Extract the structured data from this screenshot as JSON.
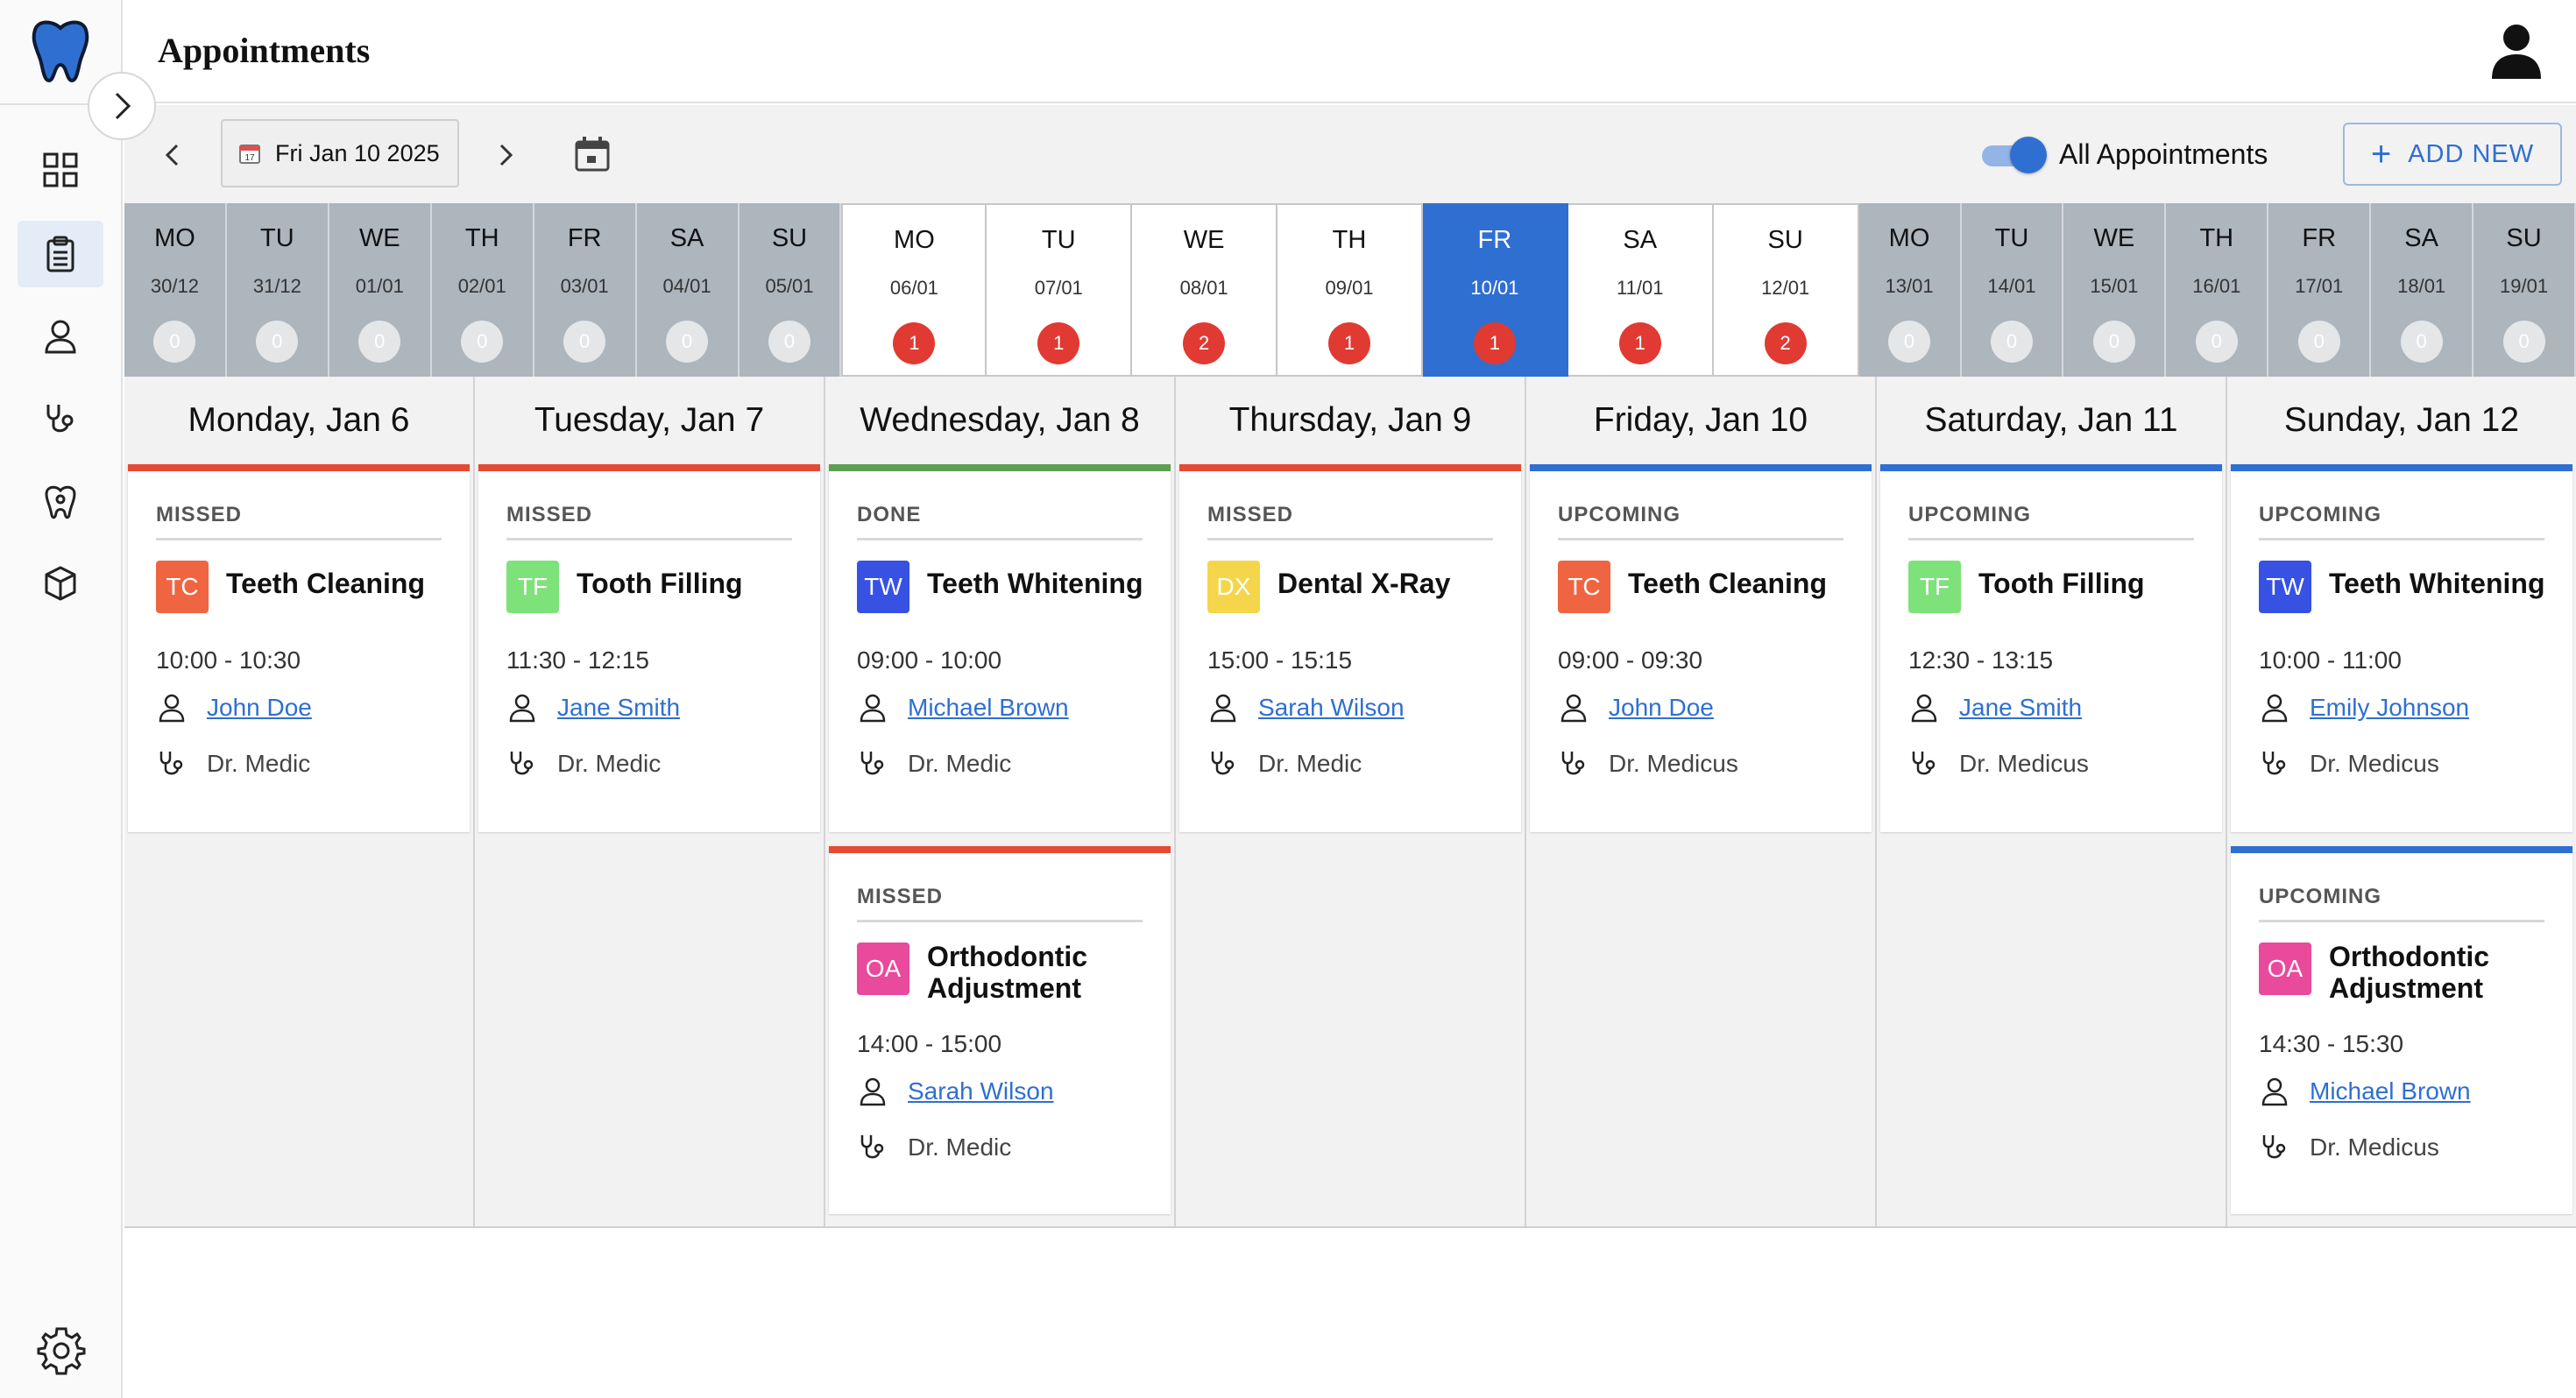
{
  "header": {
    "title": "Appointments"
  },
  "toolbar": {
    "date_label": "Fri Jan 10 2025",
    "toggle_label": "All Appointments",
    "add_new_label": "ADD NEW"
  },
  "colors": {
    "accent": "#2f6fd1",
    "missed": "#e34b34",
    "done": "#5c9f51",
    "upcoming": "#2f6fd1",
    "badge_tc": "#f06541",
    "badge_tf": "#7ee27a",
    "badge_tw": "#3751e3",
    "badge_dx": "#f5d64a",
    "badge_oa": "#e94a9b"
  },
  "days_strip": [
    {
      "dow": "MO",
      "dm": "30/12",
      "count": "0"
    },
    {
      "dow": "TU",
      "dm": "31/12",
      "count": "0"
    },
    {
      "dow": "WE",
      "dm": "01/01",
      "count": "0"
    },
    {
      "dow": "TH",
      "dm": "02/01",
      "count": "0"
    },
    {
      "dow": "FR",
      "dm": "03/01",
      "count": "0"
    },
    {
      "dow": "SA",
      "dm": "04/01",
      "count": "0"
    },
    {
      "dow": "SU",
      "dm": "05/01",
      "count": "0"
    },
    {
      "dow": "MO",
      "dm": "06/01",
      "count": "1"
    },
    {
      "dow": "TU",
      "dm": "07/01",
      "count": "1"
    },
    {
      "dow": "WE",
      "dm": "08/01",
      "count": "2"
    },
    {
      "dow": "TH",
      "dm": "09/01",
      "count": "1"
    },
    {
      "dow": "FR",
      "dm": "10/01",
      "count": "1"
    },
    {
      "dow": "SA",
      "dm": "11/01",
      "count": "1"
    },
    {
      "dow": "SU",
      "dm": "12/01",
      "count": "2"
    },
    {
      "dow": "MO",
      "dm": "13/01",
      "count": "0"
    },
    {
      "dow": "TU",
      "dm": "14/01",
      "count": "0"
    },
    {
      "dow": "WE",
      "dm": "15/01",
      "count": "0"
    },
    {
      "dow": "TH",
      "dm": "16/01",
      "count": "0"
    },
    {
      "dow": "FR",
      "dm": "17/01",
      "count": "0"
    },
    {
      "dow": "SA",
      "dm": "18/01",
      "count": "0"
    },
    {
      "dow": "SU",
      "dm": "19/01",
      "count": "0"
    }
  ],
  "week": [
    {
      "title": "Monday, Jan 6",
      "appointments": [
        {
          "status": "MISSED",
          "badge": "TC",
          "service": "Teeth Cleaning",
          "time": "10:00 - 10:30",
          "patient": "John Doe",
          "doctor": "Dr. Medic"
        }
      ]
    },
    {
      "title": "Tuesday, Jan 7",
      "appointments": [
        {
          "status": "MISSED",
          "badge": "TF",
          "service": "Tooth Filling",
          "time": "11:30 - 12:15",
          "patient": "Jane Smith",
          "doctor": "Dr. Medic"
        }
      ]
    },
    {
      "title": "Wednesday, Jan 8",
      "appointments": [
        {
          "status": "DONE",
          "badge": "TW",
          "service": "Teeth Whitening",
          "time": "09:00 - 10:00",
          "patient": "Michael Brown",
          "doctor": "Dr. Medic"
        },
        {
          "status": "MISSED",
          "badge": "OA",
          "service_line1": "Orthodontic",
          "service_line2": "Adjustment",
          "time": "14:00 - 15:00",
          "patient": "Sarah Wilson",
          "doctor": "Dr. Medic"
        }
      ]
    },
    {
      "title": "Thursday, Jan 9",
      "appointments": [
        {
          "status": "MISSED",
          "badge": "DX",
          "service": "Dental X-Ray",
          "time": "15:00 - 15:15",
          "patient": "Sarah Wilson",
          "doctor": "Dr. Medic"
        }
      ]
    },
    {
      "title": "Friday, Jan 10",
      "appointments": [
        {
          "status": "UPCOMING",
          "badge": "TC",
          "service": "Teeth Cleaning",
          "time": "09:00 - 09:30",
          "patient": "John Doe",
          "doctor": "Dr. Medicus"
        }
      ]
    },
    {
      "title": "Saturday, Jan 11",
      "appointments": [
        {
          "status": "UPCOMING",
          "badge": "TF",
          "service": "Tooth Filling",
          "time": "12:30 - 13:15",
          "patient": "Jane Smith",
          "doctor": "Dr. Medicus"
        }
      ]
    },
    {
      "title": "Sunday, Jan 12",
      "appointments": [
        {
          "status": "UPCOMING",
          "badge": "TW",
          "service": "Teeth Whitening",
          "time": "10:00 - 11:00",
          "patient": "Emily Johnson",
          "doctor": "Dr. Medicus"
        },
        {
          "status": "UPCOMING",
          "badge": "OA",
          "service_line1": "Orthodontic",
          "service_line2": "Adjustment",
          "time": "14:30 - 15:30",
          "patient": "Michael Brown",
          "doctor": "Dr. Medicus"
        }
      ]
    }
  ]
}
